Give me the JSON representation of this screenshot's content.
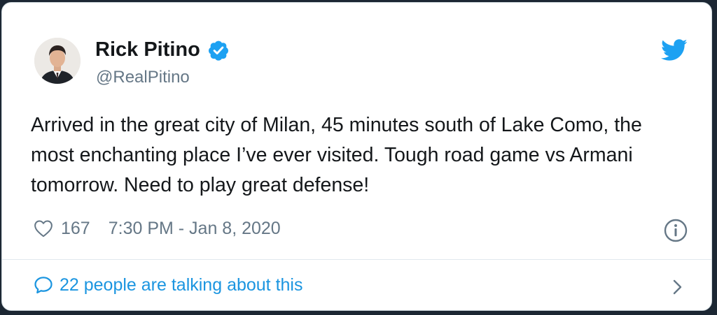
{
  "author": {
    "name": "Rick Pitino",
    "handle": "@RealPitino",
    "verified": true,
    "avatar_icon": "profile-photo"
  },
  "tweet": {
    "text": "Arrived in the great city of Milan, 45 minutes south of Lake Como, the most enchanting place I’ve ever visited. Tough road game vs Armani tomorrow. Need to play great defense!",
    "likes": "167",
    "timestamp": "7:30 PM - Jan 8, 2020"
  },
  "footer": {
    "conversation_label": "22 people are talking about this"
  },
  "icons": {
    "brand": "twitter-bird-icon",
    "verified": "verified-badge-icon",
    "like": "heart-icon",
    "info": "info-icon",
    "conversation": "speech-bubble-icon",
    "more": "chevron-right-icon"
  },
  "colors": {
    "brand_blue": "#1da1f2",
    "link_blue": "#1b95e0",
    "text": "#14171a",
    "secondary_text": "#657786"
  }
}
